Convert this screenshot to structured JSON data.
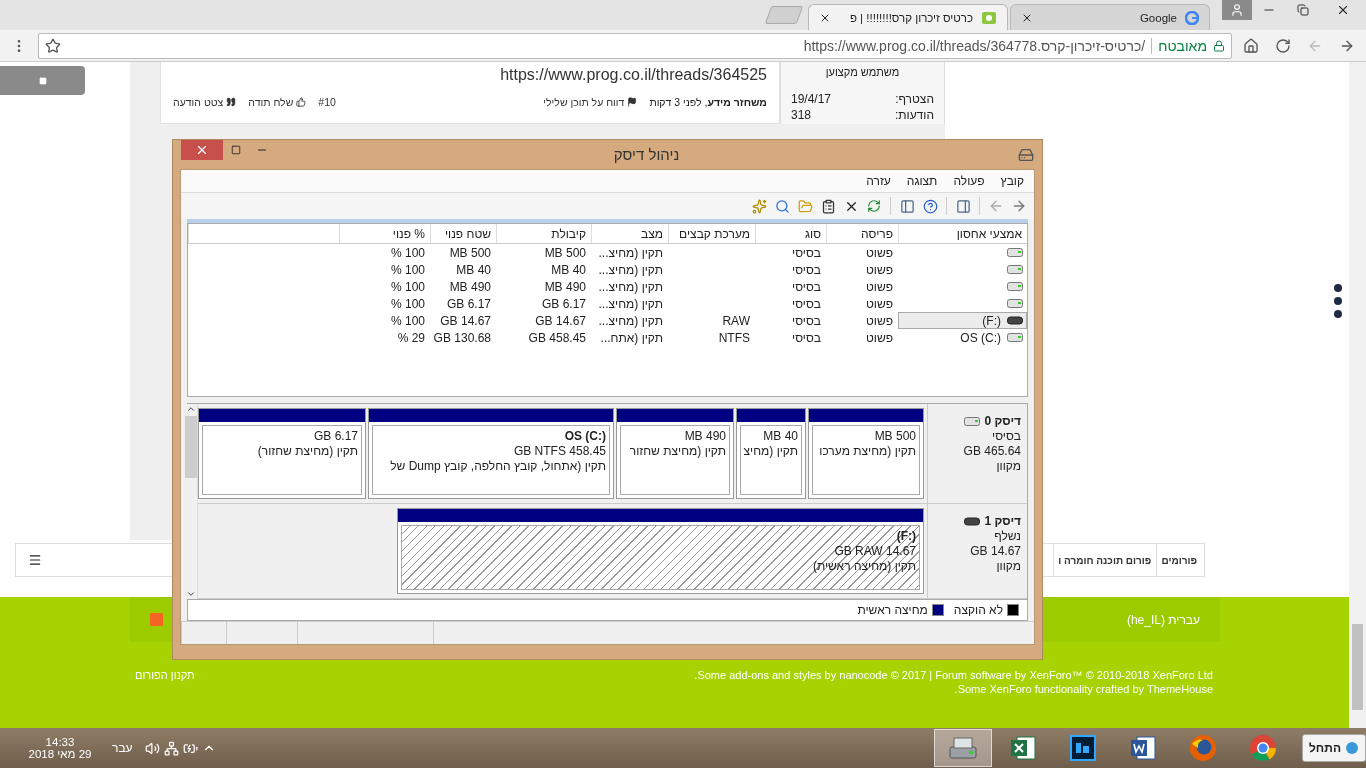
{
  "browser": {
    "tabs": [
      {
        "title": "Google",
        "selected": false
      },
      {
        "title": "כרטיס זיכרון קרס!!!!!!!! | פ",
        "selected": true
      }
    ],
    "security": "מאובטח",
    "url": "https://www.prog.co.il/threads/כרטיס-זיכרון-קרס.364778/"
  },
  "page": {
    "post": {
      "link": "https://www.prog.co.il/threads/364525",
      "author": "**משחזר מידע**, לפני 3 דקות",
      "report": "דווח על תוכן שלילי",
      "number": "#10",
      "thanks": "שלח תודה",
      "quote": "צטט הודעה"
    },
    "user_info": {
      "title": "משתמש מקצוען",
      "fields": [
        {
          "label": "הצטרף:",
          "value": "19/4/17"
        },
        {
          "label": "הודעות:",
          "value": "318"
        }
      ]
    },
    "breadcrumb": [
      "פורומים",
      "פורום תוכנה חומרה ו"
    ],
    "footer": {
      "language": "עברית (he_IL)",
      "copyright": "Some add-ons and styles by nanocode © 2017 | Forum software by XenForo™ © 2010-2018 XenForo Ltd.",
      "credit": "Some XenForo functionality crafted by ThemeHouse.",
      "rules": "תקנון הפורום"
    }
  },
  "disk_management": {
    "title": "ניהול דיסק",
    "menu": [
      "קובץ",
      "פעולה",
      "תצוגה",
      "עזרה"
    ],
    "columns": [
      "אמצעי אחסון",
      "פריסה",
      "סוג",
      "מערכת קבצים",
      "מצב",
      "קיבולת",
      "שטח פנוי",
      "% פנוי"
    ],
    "volumes": [
      {
        "kind": "fixed",
        "layout": "פשוט",
        "type": "בסיסי",
        "status": "תקין (מחיצ...",
        "capacity": "500 MB",
        "free": "500 MB",
        "percent_free": "100 %",
        "selected": false
      },
      {
        "kind": "fixed",
        "layout": "פשוט",
        "type": "בסיסי",
        "status": "תקין (מחיצ...",
        "capacity": "40 MB",
        "free": "40 MB",
        "percent_free": "100 %",
        "selected": false
      },
      {
        "kind": "fixed",
        "layout": "פשוט",
        "type": "בסיסי",
        "status": "תקין (מחיצ...",
        "capacity": "490 MB",
        "free": "490 MB",
        "percent_free": "100 %",
        "selected": false
      },
      {
        "kind": "fixed",
        "layout": "פשוט",
        "type": "בסיסי",
        "status": "תקין (מחיצ...",
        "capacity": "6.17 GB",
        "free": "6.17 GB",
        "percent_free": "100 %",
        "selected": false
      },
      {
        "kind": "removable",
        "name": "(F:)",
        "layout": "פשוט",
        "type": "בסיסי",
        "file_system": "RAW",
        "status": "תקין (מחיצ...",
        "capacity": "14.67 GB",
        "free": "14.67 GB",
        "percent_free": "100 %",
        "selected": true
      },
      {
        "kind": "fixed",
        "name": "OS (C:)",
        "layout": "פשוט",
        "type": "בסיסי",
        "file_system": "NTFS",
        "status": "תקין (אתח...",
        "capacity": "458.45 GB",
        "free": "130.68 GB",
        "percent_free": "29 %",
        "selected": false
      }
    ],
    "disks": [
      {
        "kind": "fixed",
        "name": "דיסק 0",
        "type": "בסיסי",
        "size": "465.64 GB",
        "status": "מקוון",
        "partitions": [
          {
            "size": "500 MB",
            "status": "תקין (מחיצת מערכו",
            "selected": false
          },
          {
            "size": "40 MB",
            "status": "תקין (מחיצ",
            "selected": false
          },
          {
            "size": "490 MB",
            "status": "תקין (מחיצת שחזור",
            "selected": false
          },
          {
            "label": "OS  (C:)",
            "size": "458.45 GB NTFS",
            "status": "תקין (אתחול, קובץ החלפה, קובץ Dump של",
            "selected": false
          },
          {
            "size": "6.17 GB",
            "status": "תקין (מחיצת שחזור)",
            "selected": false
          }
        ]
      },
      {
        "kind": "removable",
        "name": "דיסק 1",
        "type": "נשלף",
        "size": "14.67 GB",
        "status": "מקוון",
        "partitions": [
          {
            "label": "(F:)",
            "size": "14.67 GB RAW",
            "status": "תקין (מחיצה ראשית)",
            "selected": true
          }
        ]
      }
    ],
    "legend": [
      {
        "label": "לא הוקצה",
        "color": "#000000"
      },
      {
        "label": "מחיצה ראשית",
        "color": "#000080"
      }
    ]
  },
  "taskbar": {
    "start": "התחל",
    "apps": [
      {
        "kind": "chrome",
        "selected": false
      },
      {
        "kind": "firefox",
        "selected": false
      },
      {
        "kind": "word",
        "selected": false
      },
      {
        "kind": "photoshop",
        "selected": false
      },
      {
        "kind": "excel",
        "selected": false
      },
      {
        "kind": "disk",
        "selected": true
      }
    ],
    "language": "עבר",
    "time": "14:33",
    "date": "29 מאי 2018"
  }
}
